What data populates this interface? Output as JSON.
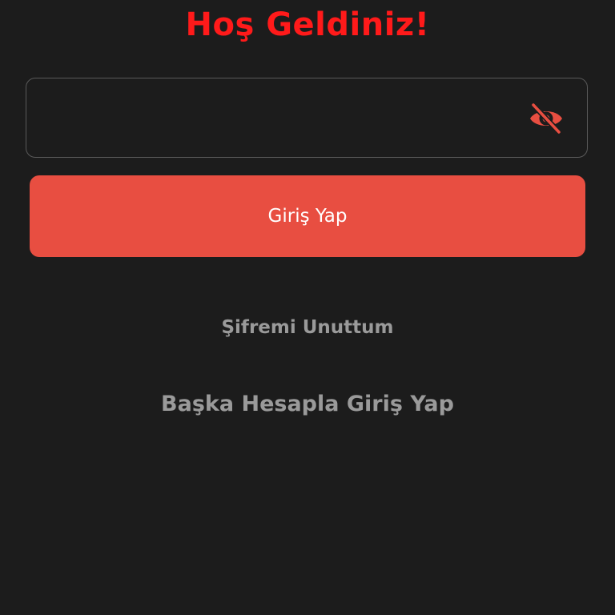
{
  "header": {
    "title": "Hoş Geldiniz!"
  },
  "password_field": {
    "value": "",
    "placeholder": "",
    "toggle_icon": "eye-off-icon"
  },
  "actions": {
    "login_label": "Giriş Yap",
    "forgot_password_label": "Şifremi Unuttum",
    "other_account_label": "Başka Hesapla Giriş Yap"
  },
  "colors": {
    "background": "#1c1c1c",
    "title": "#ff1a1a",
    "accent": "#e84e41",
    "muted_text": "#9a9a9a",
    "field_border": "#5a5a5a"
  }
}
